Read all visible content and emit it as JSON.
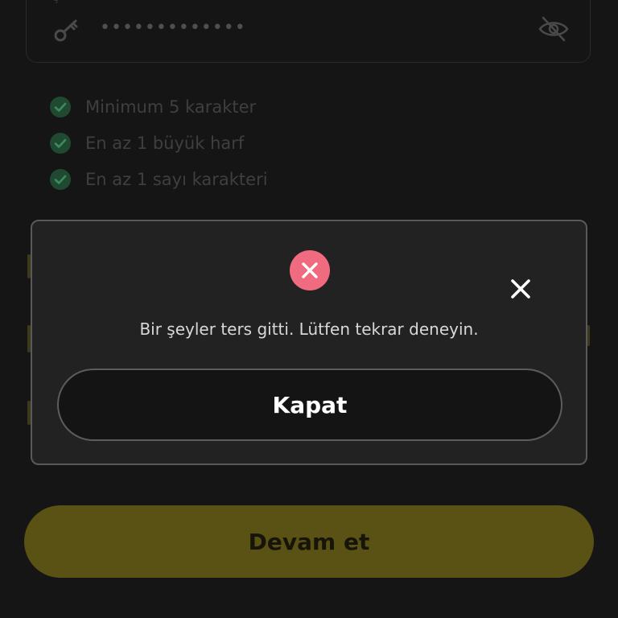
{
  "password_field": {
    "label": "Ş",
    "masked_value": "•••••••••••••",
    "key_icon": "key-icon",
    "visibility_icon": "eye-off-icon"
  },
  "rules": [
    {
      "label": "Minimum 5 karakter",
      "icon": "check-circle-icon"
    },
    {
      "label": "En az 1 büyük harf",
      "icon": "check-circle-icon"
    },
    {
      "label": "En az 1 sayı karakteri",
      "icon": "check-circle-icon"
    }
  ],
  "continue_button": {
    "label": "Devam et"
  },
  "dialog": {
    "status_icon": "error-x-icon",
    "close_icon": "close-icon",
    "message": "Bir şeyler ters gitti. Lütfen tekrar deneyin.",
    "button_label": "Kapat"
  },
  "colors": {
    "background": "#151515",
    "modal_bg": "#222222",
    "error_accent": "#f06b80",
    "success_accent": "#3aa86a",
    "primary_button": "#5a5114"
  }
}
